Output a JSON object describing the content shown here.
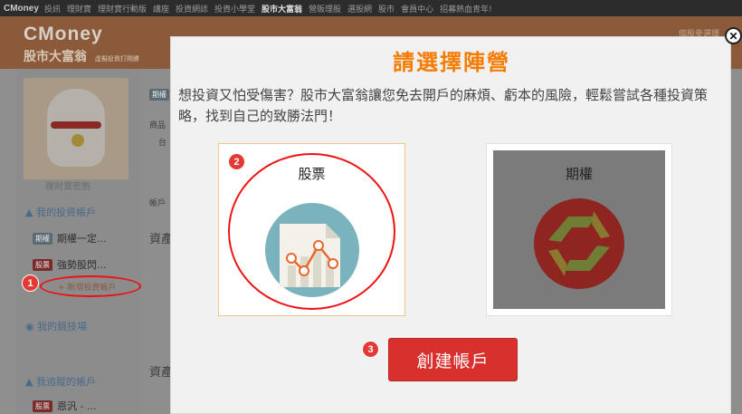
{
  "topnav": {
    "logo": "CMoney",
    "items": [
      "投訊",
      "理財寶",
      "理財寶行動版",
      "講座",
      "投資網誌",
      "投資小學堂",
      "股市大富翁",
      "營販理股",
      "選股網",
      "股市",
      "會員中心",
      "招募熱血青年!"
    ],
    "active_index": 6
  },
  "brand": {
    "title": "CMoney",
    "subtitle": "股市大富翁",
    "subtitle_small": "虛擬投資打開勝",
    "corner": "個股參選擇"
  },
  "sidebar": {
    "avatar_caption": "理財寶密胞",
    "my_accounts_label": "我的投資帳戶",
    "accounts": [
      {
        "tag": "期權",
        "name": "期權一定..."
      },
      {
        "tag": "股票",
        "name": "強勢股閃..."
      }
    ],
    "new_account_link": "+ 新增投資帳戶",
    "competition_label": "我的競技場",
    "tracked_label": "我追蹤的帳戶",
    "tracked": [
      {
        "tag": "股票",
        "name": "恩汎 - ..."
      }
    ]
  },
  "background_main": {
    "tag_text": "期權",
    "tab_label": "帳戶",
    "section_1": "資產",
    "section_2": "資產",
    "field_1": "商品",
    "field_2": "台"
  },
  "annotations": [
    "1",
    "2",
    "3"
  ],
  "modal": {
    "title": "請選擇陣營",
    "description": "想投資又怕受傷害？股市大富翁讓您免去開戶的麻煩、虧本的風險，輕鬆嘗試各種投資策略，找到自己的致勝法門！",
    "close_symbol": "✕",
    "choices": [
      {
        "label": "股票",
        "selected": true
      },
      {
        "label": "期權",
        "selected": false
      }
    ],
    "create_button": "創建帳戶"
  },
  "colors": {
    "title_orange": "#f57c00",
    "button_red": "#d8302c",
    "annotation_red": "#e53935",
    "chart_teal": "#7ab3bd"
  }
}
